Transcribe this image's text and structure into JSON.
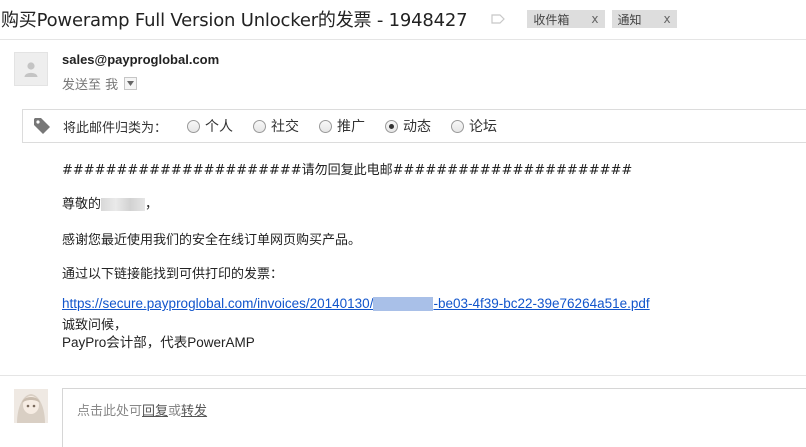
{
  "subject": "购买Poweramp Full Version Unlocker的发票 - 1948427",
  "labels": [
    {
      "text": "收件箱",
      "remove": "x"
    },
    {
      "text": "通知",
      "remove": "x"
    }
  ],
  "sender": {
    "email": "sales@payproglobal.com",
    "recipient_line": "发送至 我"
  },
  "categorize": {
    "prompt": "将此邮件归类为：",
    "options": [
      {
        "label": "个人",
        "checked": false
      },
      {
        "label": "社交",
        "checked": false
      },
      {
        "label": "推广",
        "checked": false
      },
      {
        "label": "动态",
        "checked": true
      },
      {
        "label": "论坛",
        "checked": false
      }
    ]
  },
  "body": {
    "line1": "######################请勿回复此电邮######################",
    "greeting_prefix": "尊敬的",
    "greeting_suffix": "，",
    "thanks": "感谢您最近使用我们的安全在线订单网页购买产品。",
    "invoice_intro": "通过以下链接能找到可供打印的发票：",
    "link_prefix": "https://secure.payproglobal.com/invoices/20140130/",
    "link_suffix": "-be03-4f39-bc22-39e76264a51e.pdf",
    "regards": "诚致问候，",
    "signature": "PayPro会计部，代表PowerAMP"
  },
  "reply": {
    "prefix": "点击此处可",
    "reply_link": "回复",
    "middle": "或",
    "forward_link": "转发"
  }
}
